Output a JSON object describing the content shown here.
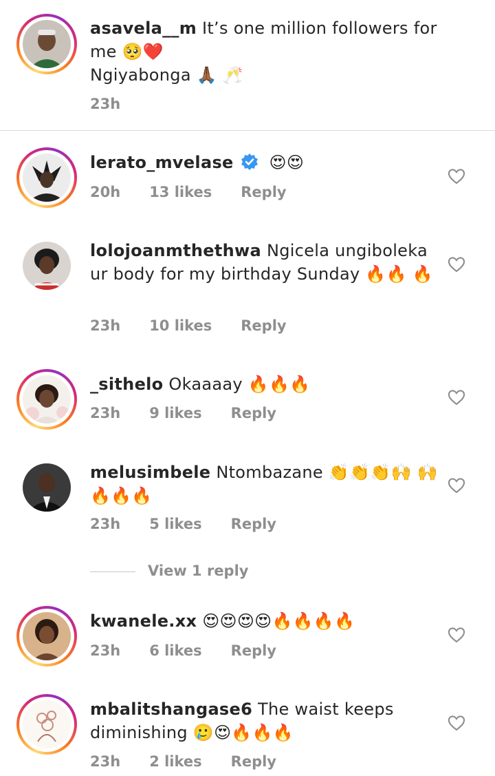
{
  "caption": {
    "username": "asavela__m",
    "text": "It’s one million followers for me 🥺❤️",
    "text2": "Ngiyabonga 🙏🏾 🥂",
    "time": "23h"
  },
  "comments": [
    {
      "username": "lerato_mvelase",
      "verified": true,
      "text": "😍😍",
      "time": "20h",
      "likes": "13 likes",
      "reply": "Reply"
    },
    {
      "username": "lolojoanmthethwa",
      "text": "Ngicela ungiboleka ur body for my birthday Sunday 🔥🔥 🔥",
      "time": "23h",
      "likes": "10 likes",
      "reply": "Reply"
    },
    {
      "username": "_sithelo",
      "text": "Okaaaay 🔥🔥🔥",
      "time": "23h",
      "likes": "9 likes",
      "reply": "Reply"
    },
    {
      "username": "melusimbele",
      "text": "Ntombazane 👏👏👏🙌 🙌🔥🔥🔥",
      "time": "23h",
      "likes": "5 likes",
      "reply": "Reply"
    },
    {
      "username": "kwanele.xx",
      "text": "😍😍😍😍🔥🔥🔥🔥",
      "time": "23h",
      "likes": "6 likes",
      "reply": "Reply"
    },
    {
      "username": "mbalitshangase6",
      "text": "The waist keeps diminishing 🥲😍🔥🔥🔥",
      "time": "23h",
      "likes": "2 likes",
      "reply": "Reply"
    }
  ],
  "view_replies": "View 1 reply",
  "icons": {
    "like": "heart-outline-icon",
    "verified": "verified-badge-icon"
  },
  "colors": {
    "meta": "#8e8e8e",
    "verified": "#3897f0",
    "text": "#262626"
  }
}
